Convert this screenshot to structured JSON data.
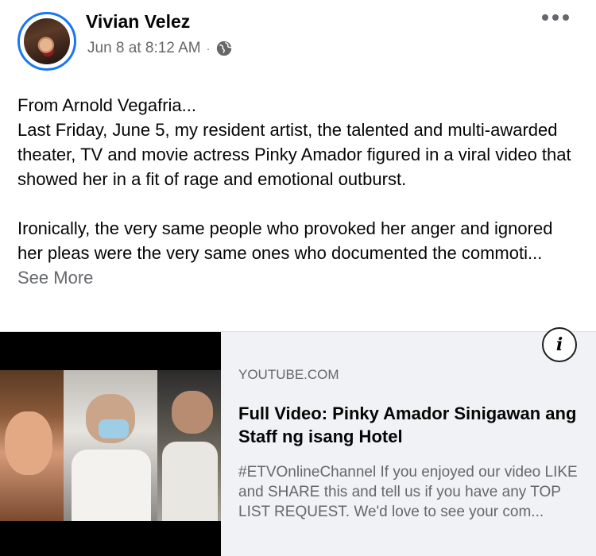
{
  "post": {
    "author": "Vivian Velez",
    "timestamp": "Jun 8 at 8:12 AM",
    "separator": "·",
    "privacy_icon": "globe-icon",
    "more_icon": "more-horizontal-icon"
  },
  "body": {
    "line1": "From Arnold Vegafria...",
    "line2": "Last Friday, June 5, my resident artist, the talented and multi-awarded theater, TV and movie actress Pinky Amador figured in a viral video that showed her in a fit of rage and emotional outburst.",
    "line3": "Ironically, the very same people who provoked her anger and ignored her pleas were the very same ones who documented the commoti...",
    "see_more": "See More"
  },
  "link_preview": {
    "domain": "YOUTUBE.COM",
    "title": "Full Video: Pinky Amador Sinigawan ang Staff ng isang Hotel",
    "description": "#ETVOnlineChannel If you enjoyed our video LIKE and SHARE this and tell us if you have any TOP LIST REQUEST. We'd love to see your com...",
    "info_label": "i"
  },
  "colors": {
    "accent": "#1877f2",
    "secondary_text": "#65676b",
    "card_bg": "#f0f2f5"
  }
}
